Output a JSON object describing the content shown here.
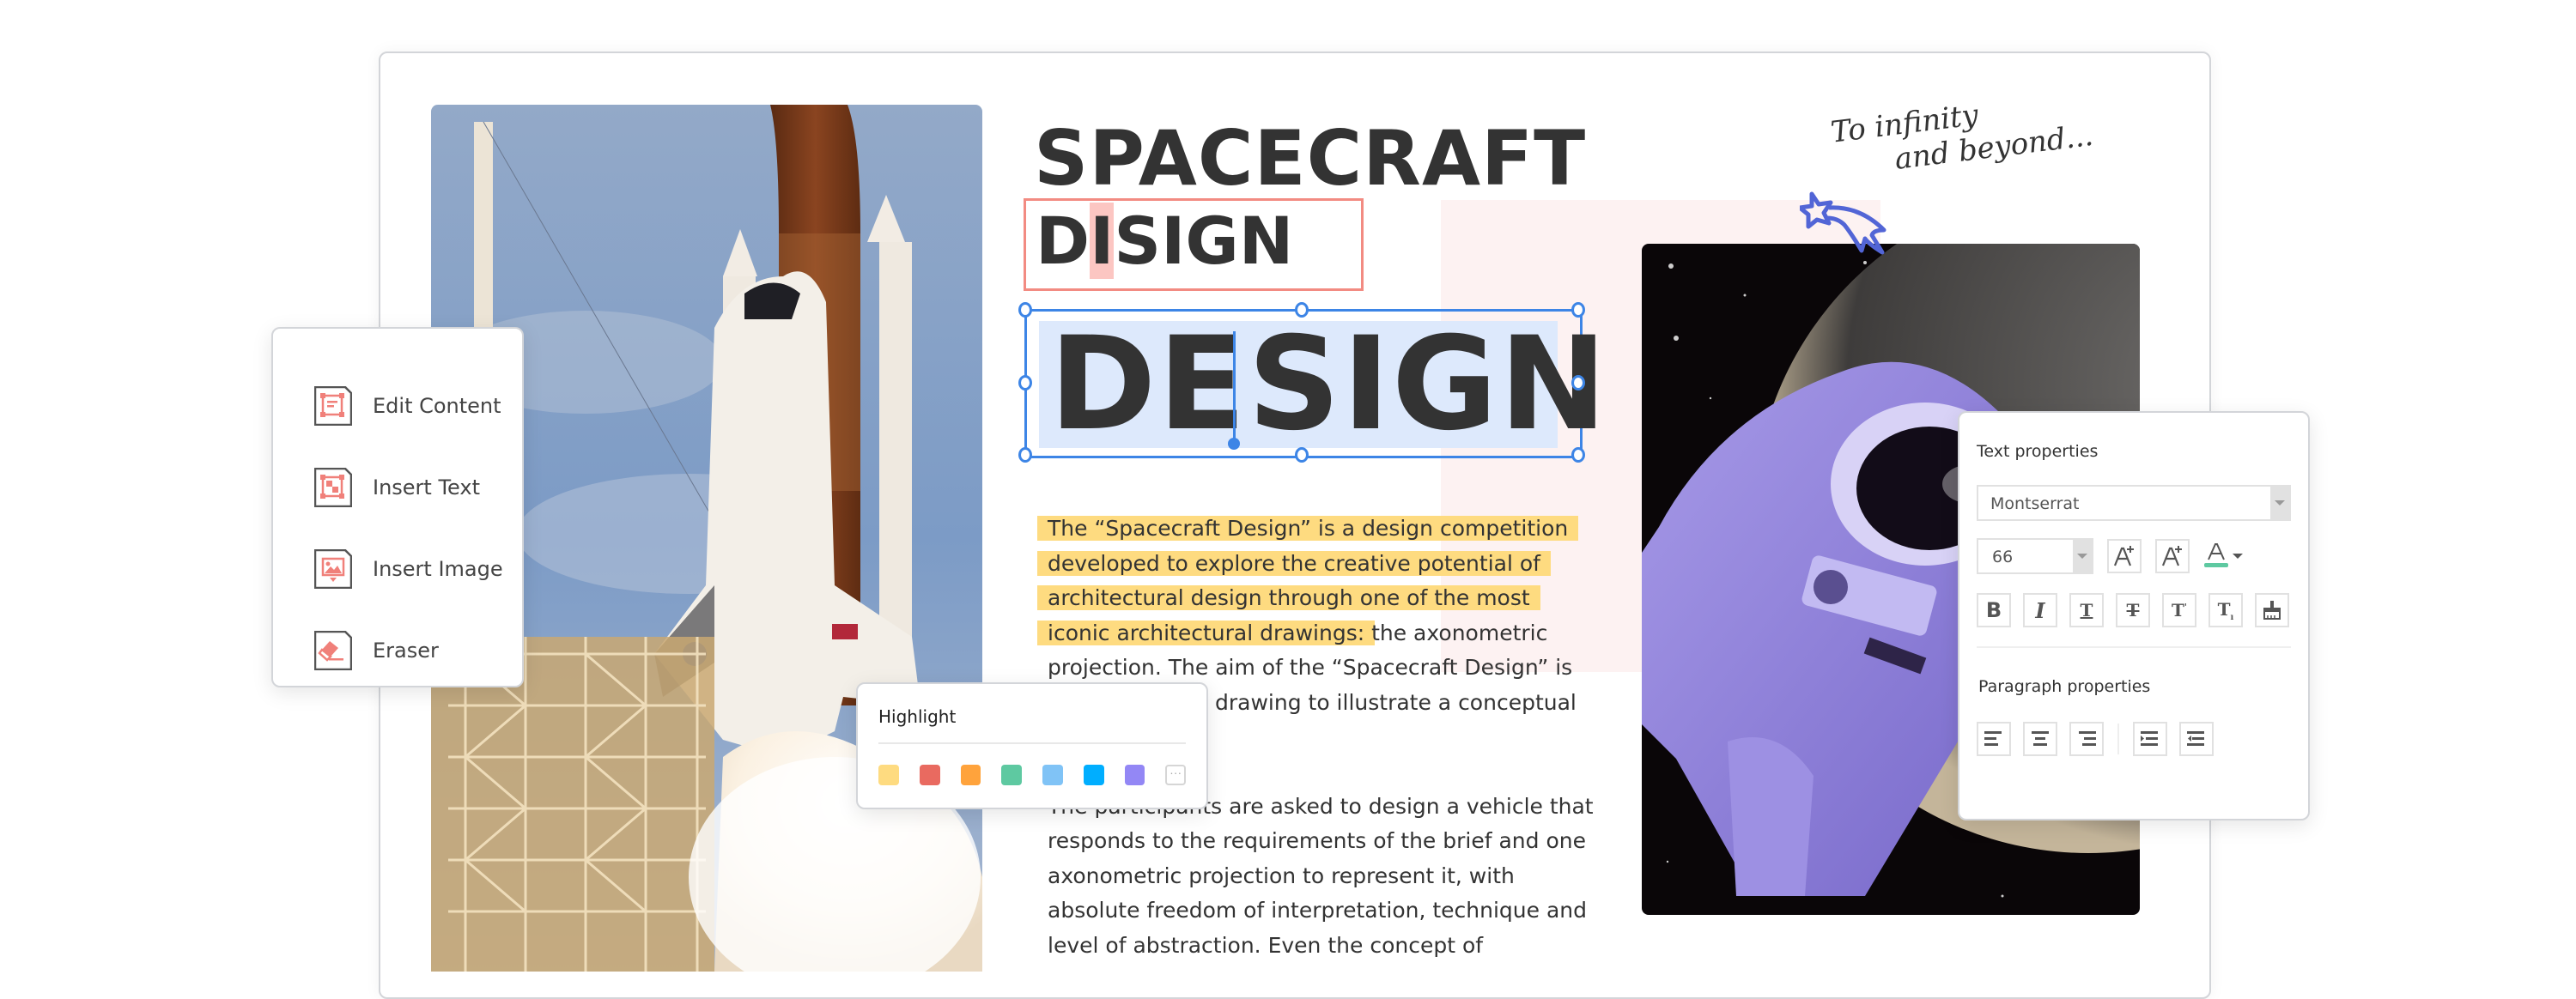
{
  "document": {
    "title_line1": "SPACECRAFT",
    "title_line2_parts": [
      "D",
      "I",
      "SIGN"
    ],
    "editing_word_parts": [
      "DE",
      "SIGN"
    ],
    "body_paragraph1_highlighted": [
      "The “Spacecraft Design” is a design competition",
      "developed to explore the creative potential of",
      "architectural design through one of the most",
      "iconic architectural drawings:"
    ],
    "body_paragraph1_rest": " the axonometric projection. The aim of the “Spacecraft Design” is to develop one drawing to illustrate a conceptual design.",
    "body_paragraph2": "The participants are asked to design a vehicle that responds to the requirements of the brief and one axonometric projection to represent it, with absolute freedom of interpretation, technique and level of abstraction. Even the concept of",
    "handwriting_line1": "To infinity",
    "handwriting_line2": "and beyond...",
    "images": {
      "left": "space-shuttle-launch-photo",
      "right": "astronaut-spacewalk-photo"
    }
  },
  "tools_panel": {
    "items": [
      {
        "label": "Edit Content",
        "icon": "edit-content-icon"
      },
      {
        "label": "Insert Text",
        "icon": "insert-text-icon"
      },
      {
        "label": "Insert Image",
        "icon": "insert-image-icon"
      },
      {
        "label": "Eraser",
        "icon": "eraser-icon"
      }
    ],
    "icon_accent": "#f0807a"
  },
  "highlight_popup": {
    "title": "Highlight",
    "colors": [
      "#fedb80",
      "#e96a60",
      "#ffa33c",
      "#5ec9a1",
      "#80c3f6",
      "#00aeff",
      "#9387f5"
    ],
    "more_label": "···"
  },
  "text_properties": {
    "title": "Text properties",
    "font_family": "Montserrat",
    "font_size": "66",
    "font_color": "#5ec9a1",
    "style_buttons": [
      "bold",
      "italic",
      "underline",
      "strikethrough",
      "superscript",
      "subscript",
      "format-painter"
    ],
    "paragraph_title": "Paragraph properties",
    "paragraph_buttons": [
      "align-left",
      "align-center",
      "align-right",
      "increase-indent",
      "decrease-indent"
    ]
  },
  "colors": {
    "selection_blue": "#3d85e6",
    "selection_fill": "#dde9fc",
    "error_box": "#f28b82",
    "highlight_yellow": "#fedb80",
    "star_doodle": "#5265d6"
  }
}
